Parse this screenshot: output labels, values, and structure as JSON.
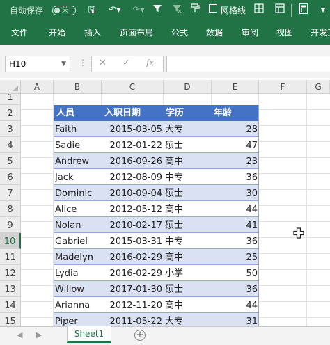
{
  "qat": {
    "autosave_label": "自动保存",
    "autosave_state": "关",
    "gridlines_label": "网格线"
  },
  "tabs": [
    "文件",
    "开始",
    "插入",
    "页面布局",
    "公式",
    "数据",
    "审阅",
    "视图",
    "开发工"
  ],
  "formula_bar": {
    "name_box": "H10",
    "fx_label": "fx",
    "value": ""
  },
  "columns": [
    "A",
    "B",
    "C",
    "D",
    "E",
    "F",
    "G"
  ],
  "rows": [
    "1",
    "2",
    "3",
    "4",
    "5",
    "6",
    "7",
    "8",
    "9",
    "10",
    "11",
    "12",
    "13",
    "14",
    "15"
  ],
  "selected_row": "10",
  "table": {
    "headers": [
      "人员",
      "入职日期",
      "学历",
      "年龄"
    ],
    "rows": [
      [
        "Faith",
        "2015-03-05",
        "大专",
        "28"
      ],
      [
        "Sadie",
        "2012-01-22",
        "硕士",
        "47"
      ],
      [
        "Andrew",
        "2016-09-26",
        "高中",
        "23"
      ],
      [
        "Jack",
        "2012-08-09",
        "中专",
        "36"
      ],
      [
        "Dominic",
        "2010-09-04",
        "硕士",
        "30"
      ],
      [
        "Alice",
        "2012-05-12",
        "高中",
        "44"
      ],
      [
        "Nolan",
        "2010-02-17",
        "硕士",
        "41"
      ],
      [
        "Gabriel",
        "2015-03-31",
        "中专",
        "36"
      ],
      [
        "Madelyn",
        "2016-02-29",
        "高中",
        "25"
      ],
      [
        "Lydia",
        "2016-02-29",
        "小学",
        "50"
      ],
      [
        "Willow",
        "2017-01-30",
        "硕士",
        "36"
      ],
      [
        "Arianna",
        "2012-11-20",
        "高中",
        "44"
      ],
      [
        "Piper",
        "2011-05-22",
        "大专",
        "31"
      ]
    ]
  },
  "sheets": [
    "Sheet1"
  ],
  "colors": {
    "brand": "#217346",
    "table_header": "#4472c4",
    "band": "#d9e1f2"
  }
}
